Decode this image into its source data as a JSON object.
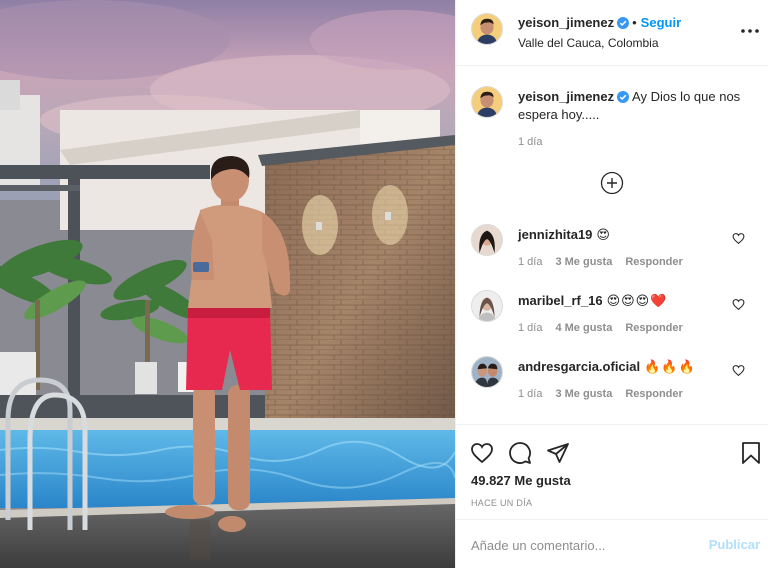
{
  "post": {
    "username": "yeison_jimenez",
    "follow_label": "Seguir",
    "separator": "•",
    "location": "Valle del Cauca, Colombia",
    "menu_icon": "more-horizontal-icon",
    "verified_icon": "verified-badge-icon"
  },
  "caption": {
    "username": "yeison_jimenez",
    "text": "Ay Dios lo que nos espera hoy.....",
    "time": "1 día"
  },
  "load_more_icon": "plus-circle-icon",
  "comments": [
    {
      "username": "jennizhita19",
      "emoji": "😍",
      "time": "1 día",
      "likes": "3 Me gusta",
      "reply": "Responder"
    },
    {
      "username": "maribel_rf_16",
      "emoji": "😍😍😍❤️",
      "time": "1 día",
      "likes": "4 Me gusta",
      "reply": "Responder"
    },
    {
      "username": "andresgarcia.oficial",
      "emoji": "🔥🔥🔥",
      "time": "1 día",
      "likes": "3 Me gusta",
      "reply": "Responder"
    }
  ],
  "actions": {
    "like_icon": "heart-icon",
    "comment_icon": "comment-icon",
    "share_icon": "send-icon",
    "save_icon": "bookmark-icon",
    "likes_count": "49.827 Me gusta",
    "posted": "Hace un día"
  },
  "add_comment": {
    "placeholder": "Añade un comentario...",
    "publish_label": "Publicar"
  },
  "colors": {
    "accent": "#0095f6",
    "publish_disabled": "#b2dffc",
    "verified": "#3897f0",
    "muted": "#8e8e8e",
    "shorts": "#e8294f"
  }
}
